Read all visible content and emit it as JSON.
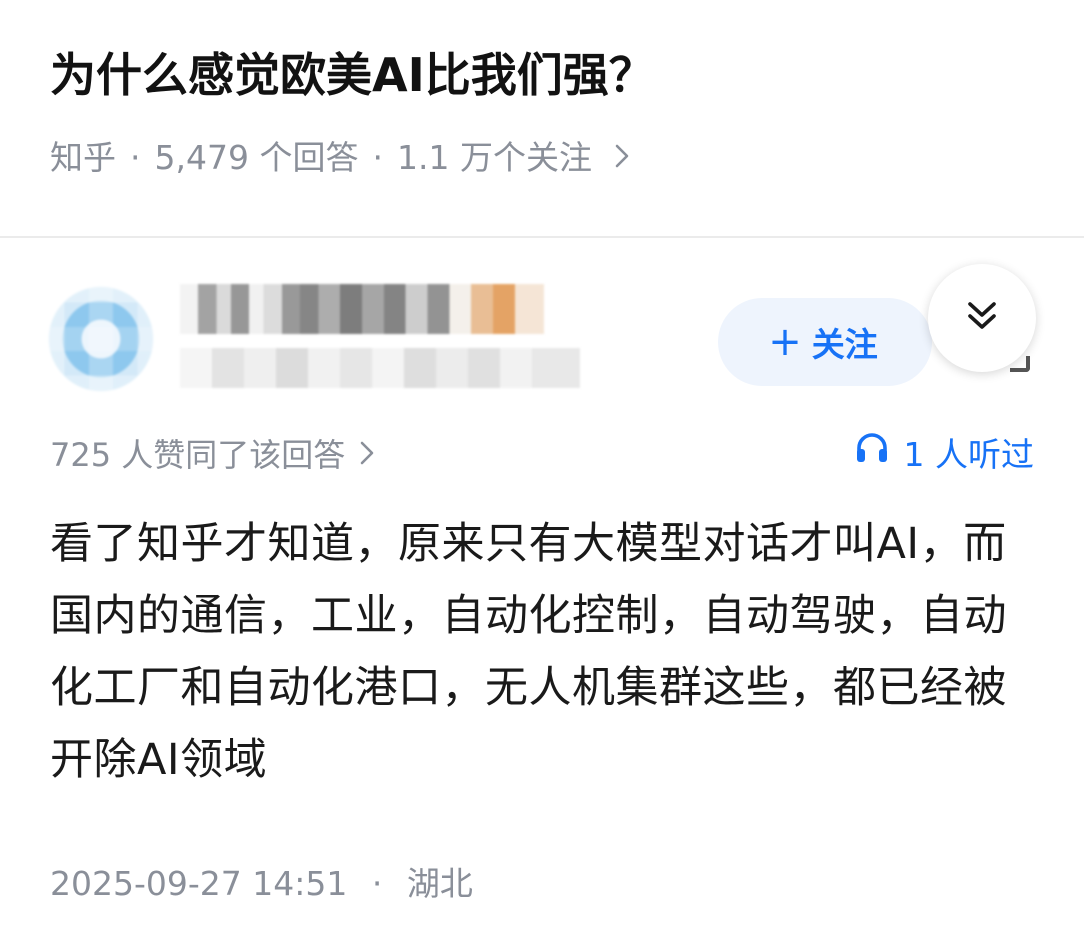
{
  "question": {
    "title": "为什么感觉欧美AI比我们强？",
    "source": "知乎",
    "separator": "·",
    "answers": "5,479 个回答",
    "followers": "1.1 万个关注",
    "more_icon": "chevron-right-icon"
  },
  "author": {
    "avatar_icon": "avatar-pixelated",
    "follow_label": "关注",
    "follow_prefix": "+",
    "collapse_icon": "double-chevron-down-icon"
  },
  "answer": {
    "likes": "725 人赞同了该回答",
    "listen_icon": "headphones-icon",
    "listen_count": "1 人听过",
    "content": "看了知乎才知道，原来只有大模型对话才叫AI，而国内的通信，工业，自动化控制，自动驾驶，自动化工厂和自动化港口，无人机集群这些，都已经被开除AI领域",
    "timestamp": "2025-09-27 14:51",
    "location": "湖北"
  },
  "colors": {
    "accent": "#1772f6",
    "follow_bg": "#eef4fd",
    "meta_gray": "#8a8f99",
    "title": "#121212"
  }
}
